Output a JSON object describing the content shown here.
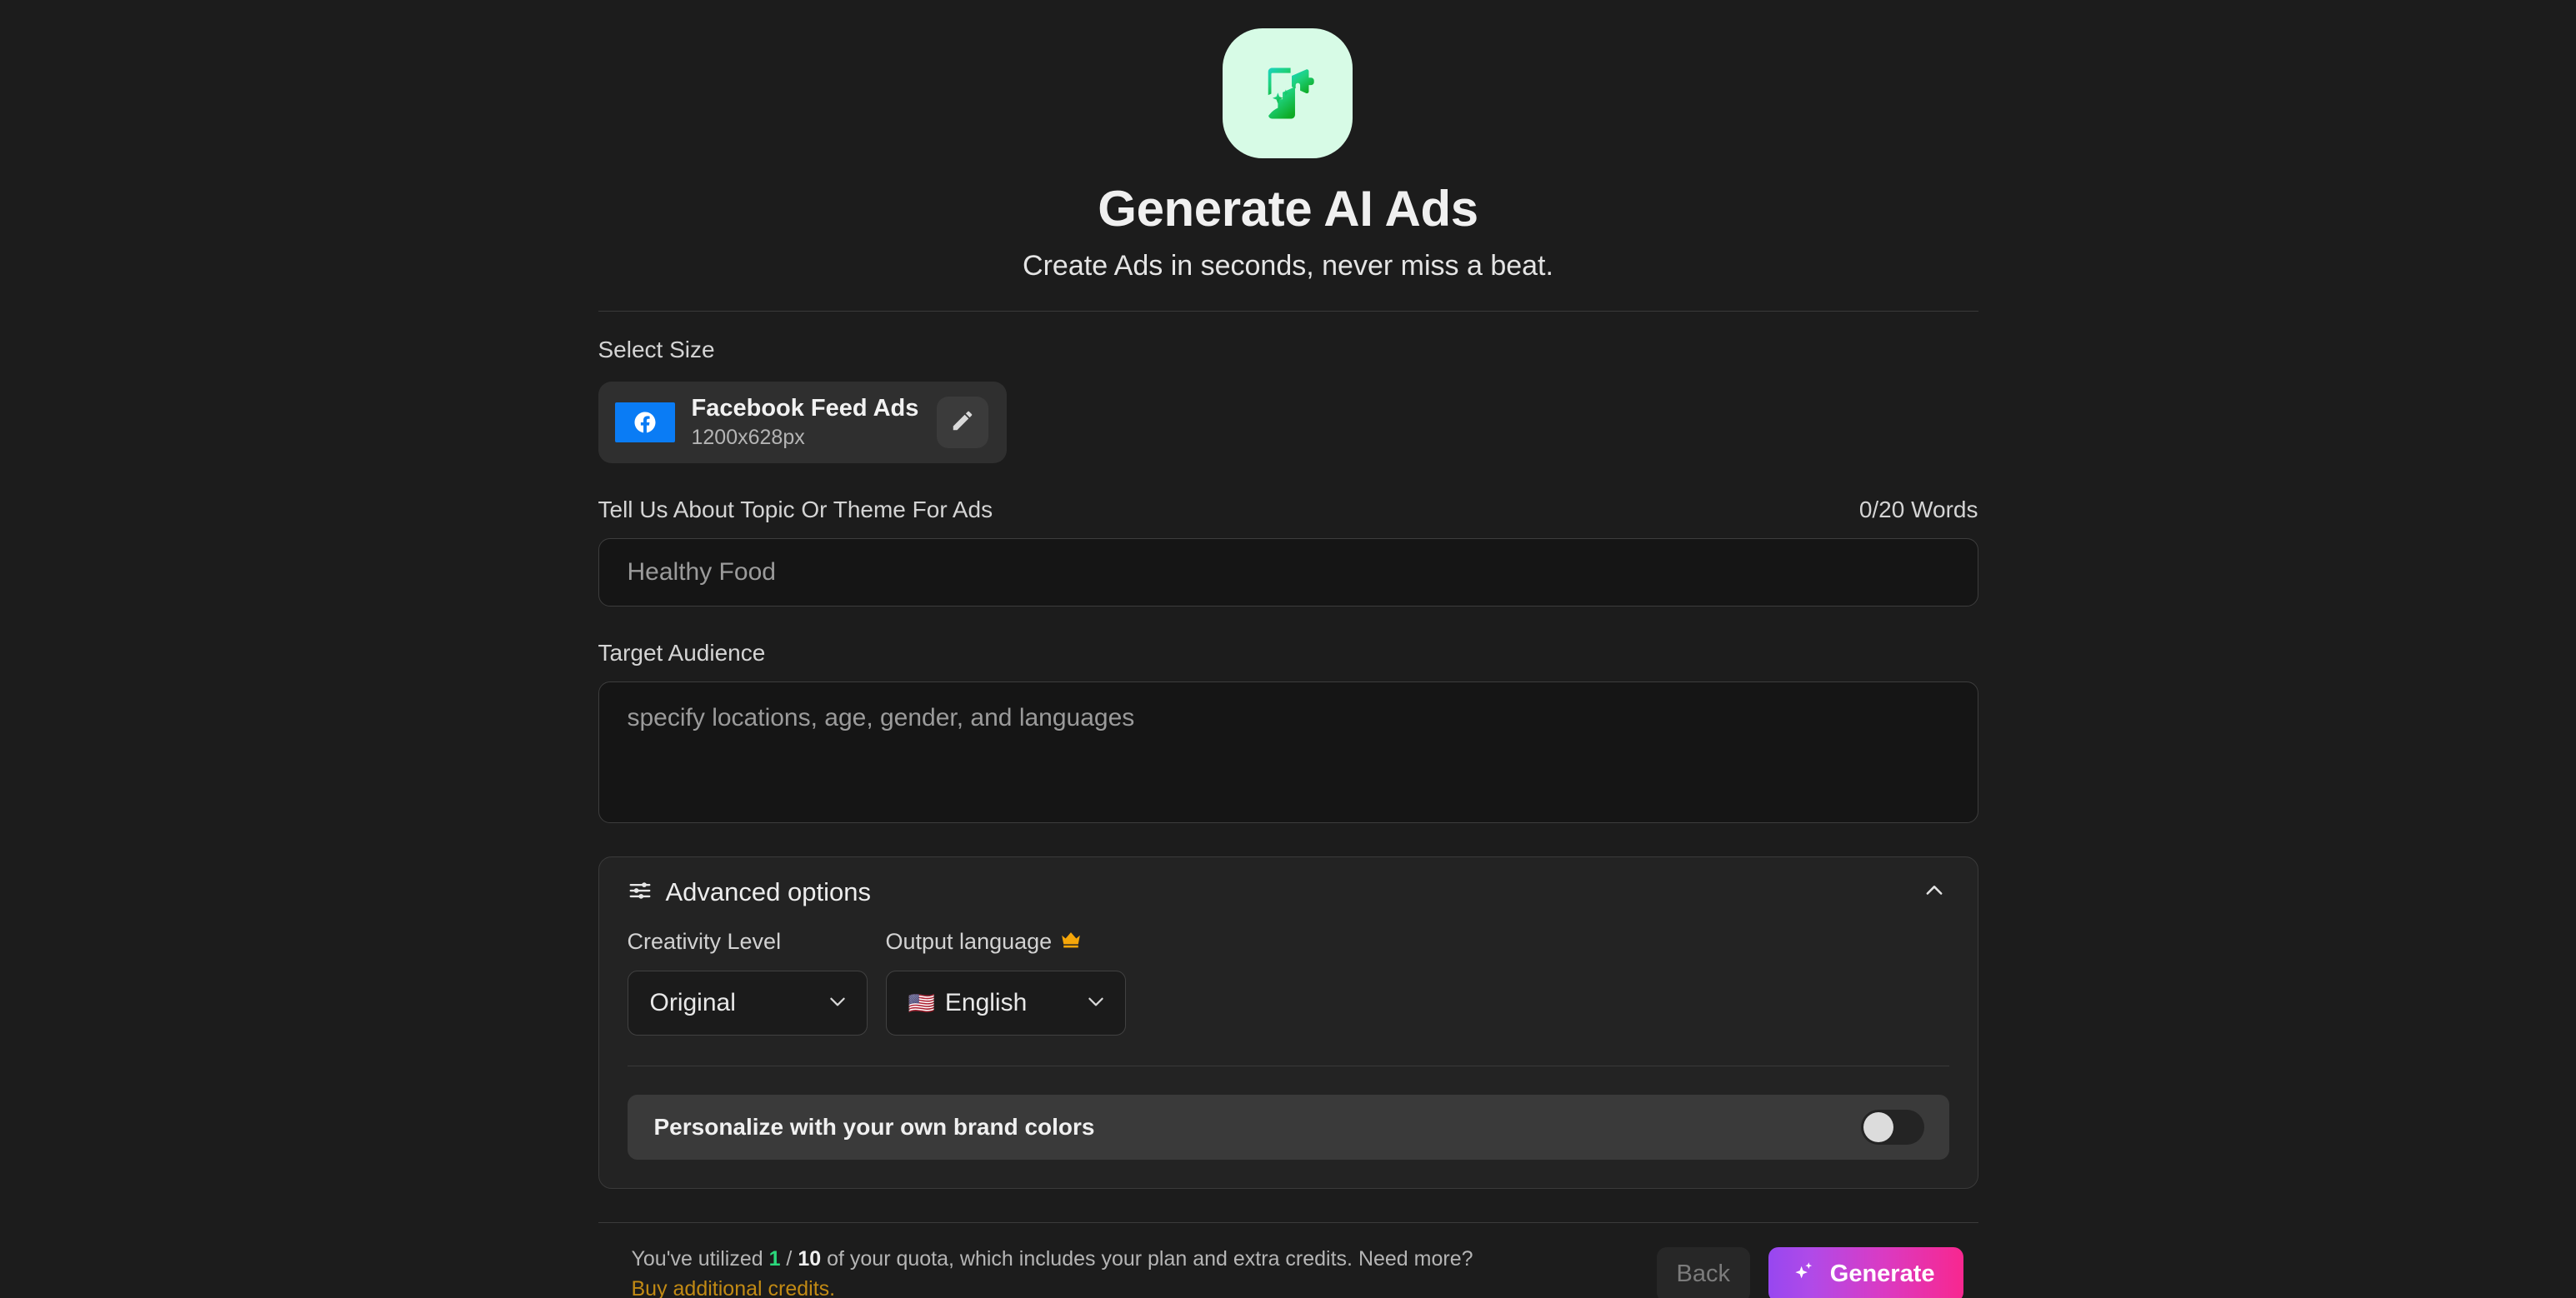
{
  "hero": {
    "icon": "megaphone-phone-sparkle-icon",
    "title": "Generate AI Ads",
    "subtitle": "Create Ads in seconds, never miss a beat."
  },
  "select_size": {
    "label": "Select Size",
    "card": {
      "platform_icon": "facebook-icon",
      "name": "Facebook Feed Ads",
      "dimensions": "1200x628px",
      "edit_icon": "pencil-icon"
    }
  },
  "topic": {
    "label": "Tell Us About Topic Or Theme For Ads",
    "counter": "0/20 Words",
    "placeholder": "Healthy Food",
    "value": ""
  },
  "audience": {
    "label": "Target Audience",
    "placeholder": "specify locations, age, gender, and languages",
    "value": ""
  },
  "advanced": {
    "icon": "sliders-icon",
    "title": "Advanced options",
    "collapse_icon": "chevron-up-icon",
    "creativity": {
      "label": "Creativity Level",
      "value": "Original",
      "chevron_icon": "chevron-down-icon"
    },
    "language": {
      "label": "Output language",
      "premium_icon": "crown-icon",
      "premium_glyph": "👑",
      "flag_glyph": "🇺🇸",
      "value": "English",
      "chevron_icon": "chevron-down-icon"
    },
    "brand_colors": {
      "label": "Personalize with your own brand colors",
      "toggle_state": "off"
    }
  },
  "footer": {
    "quota_prefix": "You've utilized ",
    "quota_used": "1",
    "quota_separator": " / ",
    "quota_total": "10",
    "quota_suffix": " of your quota, which includes your plan and extra credits. Need more?",
    "buy_link": "Buy additional credits.",
    "back_label": "Back",
    "generate_label": "Generate",
    "generate_icon": "sparkles-icon"
  },
  "colors": {
    "page_bg": "#1c1c1c",
    "badge_bg": "#d7fbe6",
    "facebook_blue": "#0a7cf5",
    "quota_used_green": "#2bd97c",
    "buy_link_amber": "#c28a14",
    "generate_gradient_start": "#9747f0",
    "generate_gradient_end": "#f8278f",
    "crown_gold": "#f5a609"
  }
}
